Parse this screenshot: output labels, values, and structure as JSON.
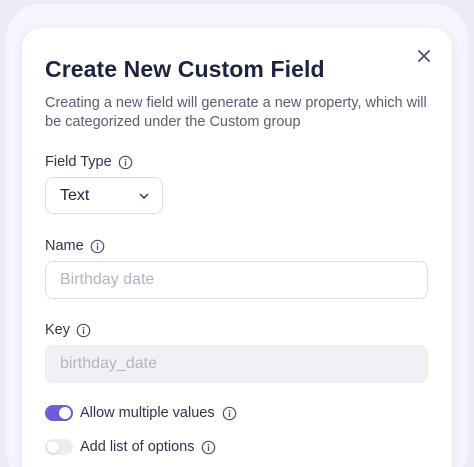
{
  "modal": {
    "title": "Create New Custom Field",
    "description": "Creating a new field will generate a new property, which will be categorized under the Custom group",
    "close_icon": "close-icon"
  },
  "field_type": {
    "label": "Field Type",
    "selected": "Text",
    "icon": "chevron-down-icon"
  },
  "name": {
    "label": "Name",
    "placeholder": "Birthday date"
  },
  "key": {
    "label": "Key",
    "placeholder": "birthday_date"
  },
  "options": {
    "allow_multiple": {
      "label": "Allow multiple values",
      "enabled": true
    },
    "add_list": {
      "label": "Add list of options",
      "enabled": false
    }
  },
  "colors": {
    "accent": "#6c5ed8",
    "title": "#1e2240",
    "text": "#2f3350",
    "muted": "#585c75",
    "placeholder": "#b2b4c4"
  }
}
